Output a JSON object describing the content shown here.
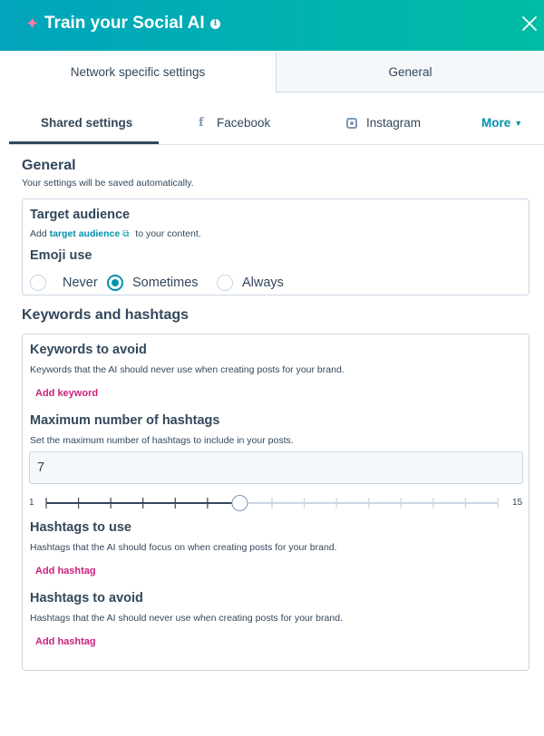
{
  "header": {
    "title": "Train your Social AI"
  },
  "top_tabs": {
    "network": "Network specific settings",
    "general": "General"
  },
  "sub_tabs": {
    "shared": "Shared settings",
    "facebook": "Facebook",
    "instagram": "Instagram",
    "more": "More"
  },
  "general": {
    "title": "General",
    "help": "Your settings will be saved automatically.",
    "target_audience": {
      "title": "Target audience",
      "prefix": "Add",
      "link": "target audience",
      "suffix": "to your content."
    },
    "emoji": {
      "title": "Emoji use",
      "options": [
        "Never",
        "Sometimes",
        "Always"
      ],
      "selected": "Sometimes"
    }
  },
  "keywords": {
    "title": "Keywords and hashtags",
    "avoid": {
      "title": "Keywords to avoid",
      "help": "Keywords that the AI should never use when creating posts for your brand.",
      "add": "Add keyword"
    },
    "max_hashtags": {
      "title": "Maximum number of hashtags",
      "help": "Set the maximum number of hashtags to include in your posts.",
      "value": "7",
      "min": "1",
      "max": "15"
    },
    "hashtags_use": {
      "title": "Hashtags to use",
      "help": "Hashtags that the AI should focus on when creating posts for your brand.",
      "add": "Add hashtag"
    },
    "hashtags_avoid": {
      "title": "Hashtags to avoid",
      "help": "Hashtags that the AI should never use when creating posts for your brand.",
      "add": "Add hashtag"
    }
  },
  "colors": {
    "accent_teal": "#00a4bd",
    "link_blue": "#0091ae",
    "add_pink": "#cc1f7e",
    "text": "#33475b"
  }
}
